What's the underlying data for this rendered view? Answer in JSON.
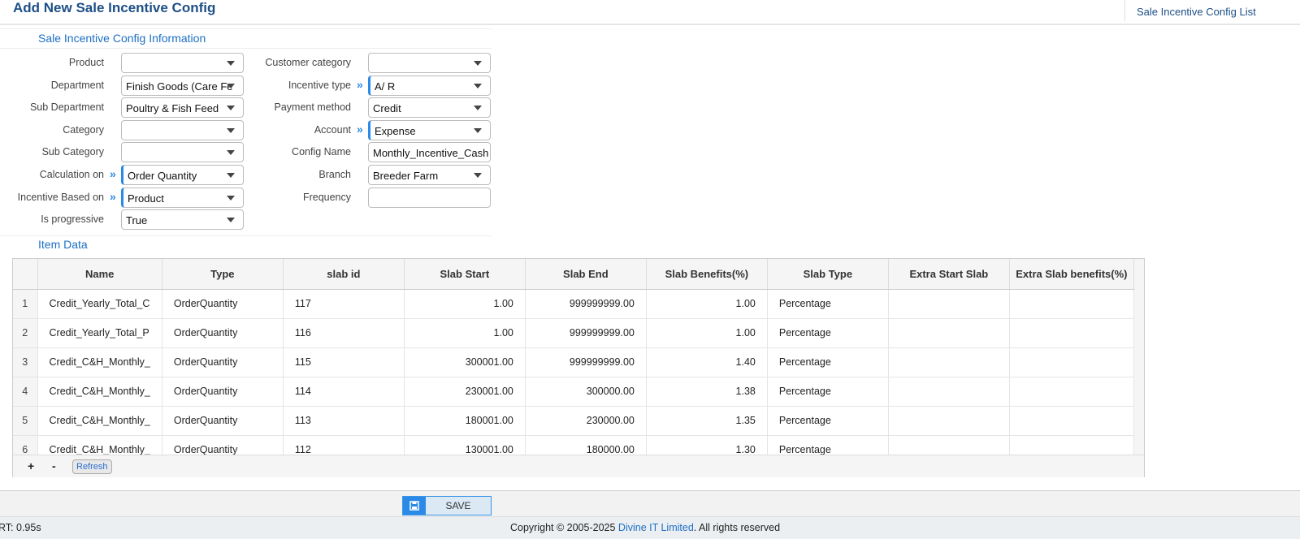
{
  "header": {
    "title": "Add New Sale Incentive Config",
    "list_link": "Sale Incentive Config List"
  },
  "form": {
    "section_title": "Sale Incentive Config Information",
    "left": [
      {
        "label": "Product",
        "value": "",
        "dropdown": true,
        "required": false
      },
      {
        "label": "Department",
        "value": "Finish Goods (Care Fe",
        "dropdown": true,
        "required": false
      },
      {
        "label": "Sub Department",
        "value": "Poultry & Fish Feed",
        "dropdown": true,
        "required": false
      },
      {
        "label": "Category",
        "value": "",
        "dropdown": true,
        "required": false
      },
      {
        "label": "Sub Category",
        "value": "",
        "dropdown": true,
        "required": false
      },
      {
        "label": "Calculation on",
        "value": "Order Quantity",
        "dropdown": true,
        "required": true
      },
      {
        "label": "Incentive Based on",
        "value": "Product",
        "dropdown": true,
        "required": true
      },
      {
        "label": "Is progressive",
        "value": "True",
        "dropdown": true,
        "required": false
      }
    ],
    "right": [
      {
        "label": "Customer category",
        "value": "",
        "dropdown": true,
        "required": false
      },
      {
        "label": "Incentive type",
        "value": "A/ R",
        "dropdown": true,
        "required": true
      },
      {
        "label": "Payment method",
        "value": "Credit",
        "dropdown": true,
        "required": false
      },
      {
        "label": "Account",
        "value": "Expense",
        "dropdown": true,
        "required": true
      },
      {
        "label": "Config Name",
        "value": "Monthly_Incentive_Cash",
        "dropdown": false,
        "required": false
      },
      {
        "label": "Branch",
        "value": "Breeder Farm",
        "dropdown": true,
        "required": false
      },
      {
        "label": "Frequency",
        "value": "",
        "dropdown": false,
        "required": false
      }
    ]
  },
  "items": {
    "section_title": "Item Data",
    "columns": [
      "Name",
      "Type",
      "slab id",
      "Slab Start",
      "Slab End",
      "Slab Benefits(%)",
      "Slab Type",
      "Extra Start Slab",
      "Extra Slab benefits(%)"
    ],
    "rows": [
      [
        "1",
        "Credit_Yearly_Total_C",
        "OrderQuantity",
        "117",
        "1.00",
        "999999999.00",
        "1.00",
        "Percentage",
        "",
        ""
      ],
      [
        "2",
        "Credit_Yearly_Total_P",
        "OrderQuantity",
        "116",
        "1.00",
        "999999999.00",
        "1.00",
        "Percentage",
        "",
        ""
      ],
      [
        "3",
        "Credit_C&H_Monthly_",
        "OrderQuantity",
        "115",
        "300001.00",
        "999999999.00",
        "1.40",
        "Percentage",
        "",
        ""
      ],
      [
        "4",
        "Credit_C&H_Monthly_",
        "OrderQuantity",
        "114",
        "230001.00",
        "300000.00",
        "1.38",
        "Percentage",
        "",
        ""
      ],
      [
        "5",
        "Credit_C&H_Monthly_",
        "OrderQuantity",
        "113",
        "180001.00",
        "230000.00",
        "1.35",
        "Percentage",
        "",
        ""
      ],
      [
        "6",
        "Credit_C&H_Monthly_",
        "OrderQuantity",
        "112",
        "130001.00",
        "180000.00",
        "1.30",
        "Percentage",
        "",
        ""
      ]
    ],
    "add": "+",
    "remove": "-",
    "refresh": "Refresh"
  },
  "footer": {
    "save": "SAVE",
    "rt": "RT: 0.95s",
    "copyright": "Copyright © 2005-2025",
    "company": "Divine IT Limited",
    "rights": ". All rights reserved"
  },
  "colors": {
    "accent": "#2a8ae6",
    "title": "#1d4f86"
  }
}
